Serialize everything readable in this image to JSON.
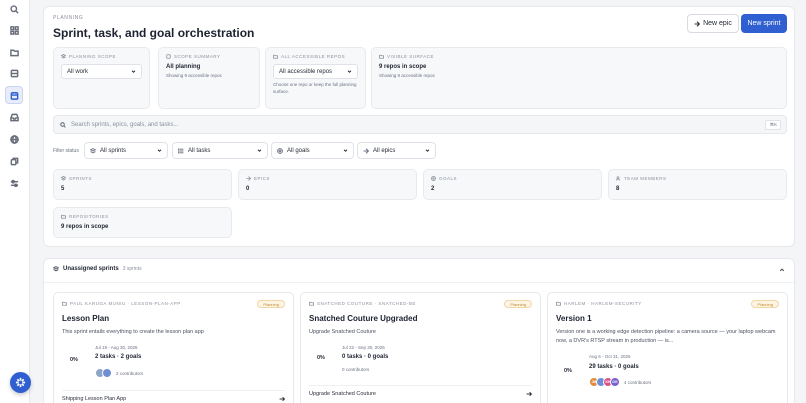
{
  "header": {
    "eyebrow": "PLANNING",
    "title": "Sprint, task, and goal orchestration",
    "new_epic_label": "New epic",
    "new_sprint_label": "New sprint"
  },
  "scope": {
    "planning_scope": {
      "heading": "PLANNING SCOPE",
      "value": "All work"
    },
    "scope_summary": {
      "heading": "SCOPE SUMMARY",
      "value": "All planning",
      "sub": "Showing 9 accessible repos"
    },
    "accessible_repos": {
      "heading": "ALL ACCESSIBLE REPOS",
      "value": "All accessible repos",
      "sub": "Choose one repo or keep the full planning surface."
    },
    "visible_surface": {
      "heading": "VISIBLE SURFACE",
      "value": "9 repos in scope",
      "sub": "Showing 9 accessible repos"
    }
  },
  "search": {
    "placeholder": "Search sprints, epics, goals, and tasks...",
    "shortcut": "⌘K"
  },
  "filters": {
    "label": "Filter status",
    "sprints": "All sprints",
    "tasks": "All tasks",
    "goals": "All goals",
    "epics": "All epics"
  },
  "stats": {
    "sprints": {
      "label": "SPRINTS",
      "value": "5"
    },
    "epics": {
      "label": "EPICS",
      "value": "0"
    },
    "goals": {
      "label": "GOALS",
      "value": "2"
    },
    "team_members": {
      "label": "TEAM MEMBERS",
      "value": "8"
    },
    "repositories": {
      "label": "REPOSITORIES",
      "value": "9 repos in scope"
    }
  },
  "unassigned": {
    "title": "Unassigned sprints",
    "count": "3 sprints",
    "sprints": [
      {
        "crumb": "PAUL KARUGA MUNIU · LESSON-PLAN-APP",
        "status": "Planning",
        "title": "Lesson Plan",
        "description": "This sprint entails everything to create the lesson plan app",
        "progress": "0%",
        "dates": "Jul 19 - Aug 30, 2026",
        "tasks": "2 tasks · 2 goals",
        "contributors": "2 contributors",
        "footer": "Shipping Lesson Plan App"
      },
      {
        "crumb": "SNATCHED COUTURE · SNATCHED-BE",
        "status": "Planning",
        "title": "Snatched Couture Upgraded",
        "description": "Upgrade Snatched Couture",
        "progress": "0%",
        "dates": "Jul 22 - Sep 30, 2026",
        "tasks": "0 tasks · 0 goals",
        "contributors": "0 contributors",
        "footer": "Upgrade Snatched Couture"
      },
      {
        "crumb": "HARLEM · HARLEM-SECURITY",
        "status": "Planning",
        "title": "Version 1",
        "description": "Version one is a working edge detection pipeline: a camera source — your laptop webcam now, a DVR's RTSP stream in production — is...",
        "progress": "0%",
        "dates": "Aug 6 - Oct 31, 2026",
        "tasks": "29 tasks · 0 goals",
        "contributors": "4 contributors",
        "footer": ""
      }
    ],
    "avatars": [
      "JM",
      "KH",
      "DG"
    ]
  }
}
